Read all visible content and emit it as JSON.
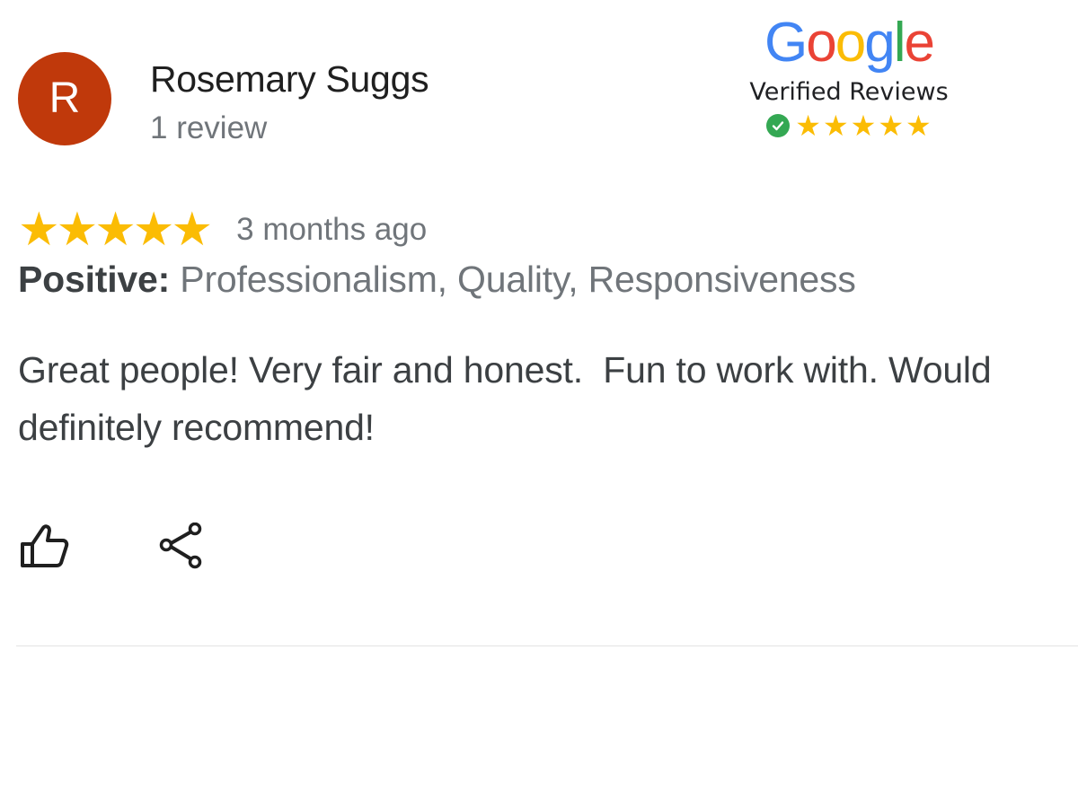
{
  "reviewer": {
    "initial": "R",
    "name": "Rosemary Suggs",
    "review_count": "1 review",
    "avatar_color": "#c0390b"
  },
  "badge": {
    "logo_letters": [
      {
        "char": "G",
        "color": "#4285f4"
      },
      {
        "char": "o",
        "color": "#ea4335"
      },
      {
        "char": "o",
        "color": "#fbbc05"
      },
      {
        "char": "g",
        "color": "#4285f4"
      },
      {
        "char": "l",
        "color": "#34a853"
      },
      {
        "char": "e",
        "color": "#ea4335"
      }
    ],
    "label": "Verified Reviews",
    "stars": 5,
    "check_color": "#34a853"
  },
  "review": {
    "rating": 5,
    "star_color": "#fbbc04",
    "date": "3 months ago",
    "positive_label": "Positive:",
    "positive_values": "Professionalism, Quality, Responsiveness",
    "text": "Great people! Very fair and honest.  Fun to work with. Would definitely recommend!"
  },
  "actions": {
    "like_icon": "thumbs-up-icon",
    "share_icon": "share-icon"
  }
}
